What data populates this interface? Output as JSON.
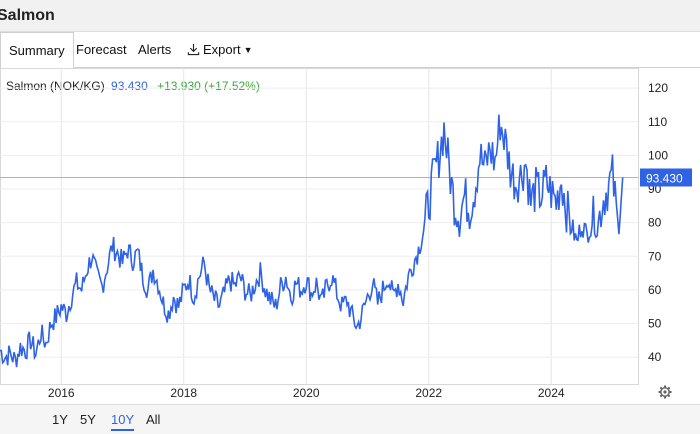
{
  "window": {
    "title": "Salmon"
  },
  "tabs": [
    {
      "label": "Summary",
      "active": true
    },
    {
      "label": "Forecast",
      "active": false
    },
    {
      "label": "Alerts",
      "active": false
    },
    {
      "label": "Export",
      "active": false,
      "icon": "download-icon"
    }
  ],
  "header": {
    "instrument": "Salmon (NOK/KG)",
    "price": "93.430",
    "change": "+13.930 (+17.52%)"
  },
  "price_marker": "93.430",
  "colors": {
    "line": "#2f63e6",
    "positive": "#3aa63a",
    "accent": "#2f63e6"
  },
  "range_buttons": [
    {
      "label": "1Y",
      "active": false
    },
    {
      "label": "5Y",
      "active": false
    },
    {
      "label": "10Y",
      "active": true
    },
    {
      "label": "All",
      "active": false
    }
  ],
  "chart_data": {
    "type": "line",
    "xlabel": "",
    "ylabel": "",
    "x_ticks": [
      "2016",
      "2018",
      "2020",
      "2022",
      "2024"
    ],
    "y_ticks": [
      40,
      50,
      60,
      70,
      80,
      90,
      100,
      110,
      120
    ],
    "ylim": [
      32,
      126
    ],
    "xlim": [
      "2015-01",
      "2025-06"
    ],
    "grid": true,
    "series": [
      {
        "values": [
          [
            "2015-01",
            42
          ],
          [
            "2015-02",
            40
          ],
          [
            "2015-03",
            41
          ],
          [
            "2015-04",
            39
          ],
          [
            "2015-05",
            43
          ],
          [
            "2015-06",
            42
          ],
          [
            "2015-07",
            45
          ],
          [
            "2015-08",
            41
          ],
          [
            "2015-09",
            47
          ],
          [
            "2015-10",
            44
          ],
          [
            "2015-11",
            50
          ],
          [
            "2015-12",
            52
          ],
          [
            "2016-01",
            55
          ],
          [
            "2016-02",
            53
          ],
          [
            "2016-03",
            58
          ],
          [
            "2016-04",
            62
          ],
          [
            "2016-05",
            60
          ],
          [
            "2016-06",
            66
          ],
          [
            "2016-07",
            70
          ],
          [
            "2016-08",
            64
          ],
          [
            "2016-09",
            61
          ],
          [
            "2016-10",
            67
          ],
          [
            "2016-11",
            73
          ],
          [
            "2016-12",
            71
          ],
          [
            "2017-01",
            68
          ],
          [
            "2017-02",
            72
          ],
          [
            "2017-03",
            69
          ],
          [
            "2017-04",
            71
          ],
          [
            "2017-05",
            64
          ],
          [
            "2017-06",
            60
          ],
          [
            "2017-07",
            66
          ],
          [
            "2017-08",
            62
          ],
          [
            "2017-09",
            56
          ],
          [
            "2017-10",
            53
          ],
          [
            "2017-11",
            58
          ],
          [
            "2017-12",
            55
          ],
          [
            "2018-01",
            60
          ],
          [
            "2018-02",
            63
          ],
          [
            "2018-03",
            58
          ],
          [
            "2018-04",
            64
          ],
          [
            "2018-05",
            68
          ],
          [
            "2018-06",
            60
          ],
          [
            "2018-07",
            57
          ],
          [
            "2018-08",
            55
          ],
          [
            "2018-09",
            59
          ],
          [
            "2018-10",
            63
          ],
          [
            "2018-11",
            61
          ],
          [
            "2018-12",
            64
          ],
          [
            "2019-01",
            60
          ],
          [
            "2019-02",
            58
          ],
          [
            "2019-03",
            62
          ],
          [
            "2019-04",
            65
          ],
          [
            "2019-05",
            60
          ],
          [
            "2019-06",
            57
          ],
          [
            "2019-07",
            55
          ],
          [
            "2019-08",
            61
          ],
          [
            "2019-09",
            64
          ],
          [
            "2019-10",
            58
          ],
          [
            "2019-11",
            62
          ],
          [
            "2019-12",
            60
          ],
          [
            "2020-01",
            63
          ],
          [
            "2020-02",
            59
          ],
          [
            "2020-03",
            62
          ],
          [
            "2020-04",
            56
          ],
          [
            "2020-05",
            61
          ],
          [
            "2020-06",
            64
          ],
          [
            "2020-07",
            59
          ],
          [
            "2020-08",
            55
          ],
          [
            "2020-09",
            57
          ],
          [
            "2020-10",
            52
          ],
          [
            "2020-11",
            49
          ],
          [
            "2020-12",
            53
          ],
          [
            "2021-01",
            58
          ],
          [
            "2021-02",
            62
          ],
          [
            "2021-03",
            56
          ],
          [
            "2021-04",
            60
          ],
          [
            "2021-05",
            64
          ],
          [
            "2021-06",
            58
          ],
          [
            "2021-07",
            62
          ],
          [
            "2021-08",
            57
          ],
          [
            "2021-09",
            64
          ],
          [
            "2021-10",
            68
          ],
          [
            "2021-11",
            72
          ],
          [
            "2021-12",
            78
          ],
          [
            "2022-01",
            86
          ],
          [
            "2022-02",
            94
          ],
          [
            "2022-03",
            100
          ],
          [
            "2022-04",
            108
          ],
          [
            "2022-05",
            96
          ],
          [
            "2022-06",
            86
          ],
          [
            "2022-07",
            82
          ],
          [
            "2022-08",
            88
          ],
          [
            "2022-09",
            84
          ],
          [
            "2022-10",
            90
          ],
          [
            "2022-11",
            100
          ],
          [
            "2022-12",
            96
          ],
          [
            "2023-01",
            102
          ],
          [
            "2023-02",
            98
          ],
          [
            "2023-03",
            110
          ],
          [
            "2023-04",
            104
          ],
          [
            "2023-05",
            96
          ],
          [
            "2023-06",
            92
          ],
          [
            "2023-07",
            94
          ],
          [
            "2023-08",
            98
          ],
          [
            "2023-09",
            86
          ],
          [
            "2023-10",
            90
          ],
          [
            "2023-11",
            88
          ],
          [
            "2023-12",
            92
          ],
          [
            "2024-01",
            89
          ],
          [
            "2024-02",
            86
          ],
          [
            "2024-03",
            93
          ],
          [
            "2024-04",
            84
          ],
          [
            "2024-05",
            79
          ],
          [
            "2024-06",
            74
          ],
          [
            "2024-07",
            80
          ],
          [
            "2024-08",
            76
          ],
          [
            "2024-09",
            82
          ],
          [
            "2024-10",
            78
          ],
          [
            "2024-11",
            86
          ],
          [
            "2024-12",
            90
          ],
          [
            "2025-01",
            94
          ],
          [
            "2025-02",
            80
          ],
          [
            "2025-03",
            93.43
          ]
        ]
      }
    ]
  }
}
